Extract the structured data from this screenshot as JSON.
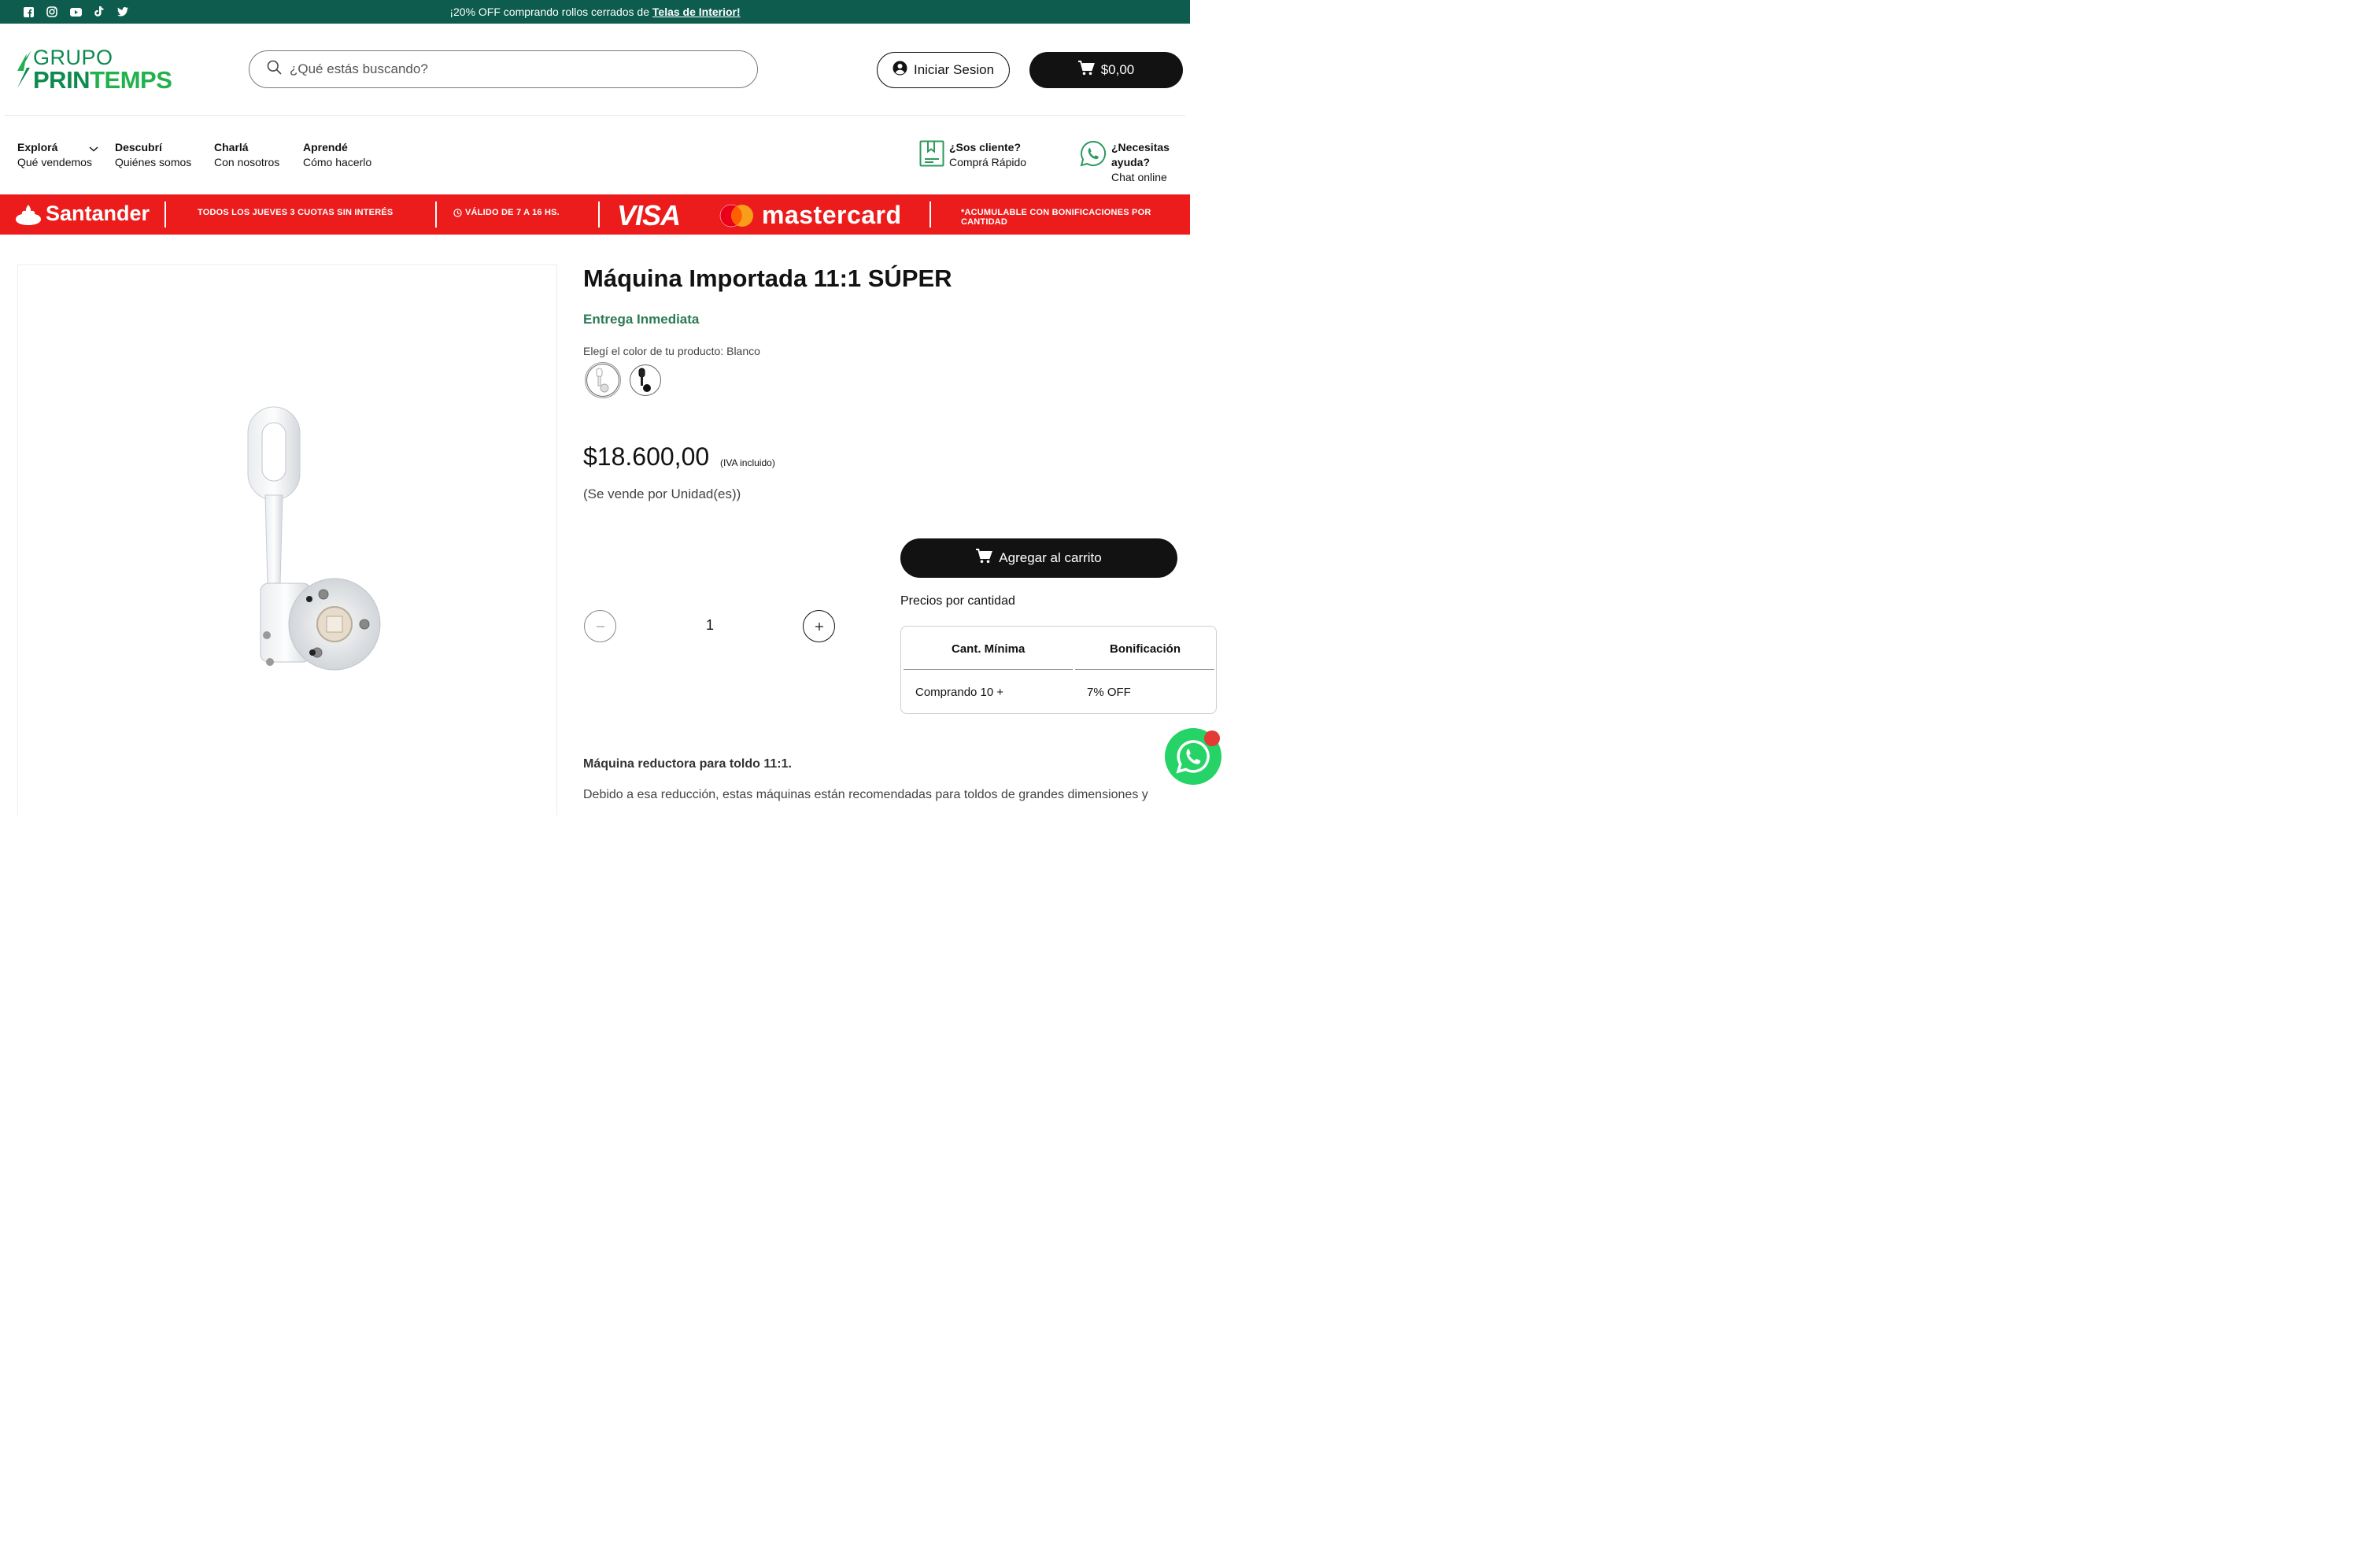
{
  "announcement": {
    "prefix": "¡20% OFF comprando rollos cerrados de ",
    "link": "Telas de Interior!"
  },
  "social_icons": [
    "facebook-icon",
    "instagram-icon",
    "youtube-icon",
    "tiktok-icon",
    "twitter-icon"
  ],
  "logo": {
    "top": "GRUPO",
    "bottom_a": "PRIN",
    "bottom_b": "TEMPS"
  },
  "search": {
    "placeholder": "¿Qué estás buscando?"
  },
  "account": {
    "login_label": "Iniciar Sesion"
  },
  "cart": {
    "total": "$0,00"
  },
  "nav": [
    {
      "title": "Explorá",
      "subtitle": "Qué vendemos"
    },
    {
      "title": "Descubrí",
      "subtitle": "Quiénes somos"
    },
    {
      "title": "Charlá",
      "subtitle": "Con nosotros"
    },
    {
      "title": "Aprendé",
      "subtitle": "Cómo hacerlo"
    }
  ],
  "help": {
    "client": {
      "title": "¿Sos cliente?",
      "subtitle": "Comprá Rápido"
    },
    "support": {
      "title": "¿Necesitas ayuda?",
      "subtitle": "Chat online"
    }
  },
  "promo": {
    "bank": "Santander",
    "offer": "TODOS LOS JUEVES 3 CUOTAS SIN INTERÉS",
    "hours": "VÁLIDO DE 7 A 16 HS.",
    "card1": "VISA",
    "card2": "mastercard",
    "note": "*ACUMULABLE CON BONIFICACIONES POR CANTIDAD",
    "color": "#ec1c1c"
  },
  "product": {
    "title": "Máquina Importada 11:1 SÚPER",
    "availability": "Entrega Inmediata",
    "color_label": "Elegí el color de tu producto: Blanco",
    "price": "$18.600,00",
    "tax_note": "(IVA incluido)",
    "unit_note": "(Se vende por Unidad(es))",
    "quantity": "1",
    "add_to_cart": "Agregar al carrito",
    "bulk_label": "Precios por cantidad",
    "bulk_table": {
      "headers": [
        "Cant. Mínima",
        "Bonificación"
      ],
      "rows": [
        [
          "Comprando 10 +",
          "7% OFF"
        ]
      ]
    },
    "desc_title": "Máquina reductora para toldo 11:1.",
    "desc_text": "Debido a esa reducción, estas máquinas están recomendadas para toldos de grandes dimensiones y"
  },
  "colors": {
    "brand_green": "#0e8a4e",
    "announce_bg": "#0d5c4e",
    "availability_green": "#2c7a55",
    "whatsapp": "#25d366"
  }
}
